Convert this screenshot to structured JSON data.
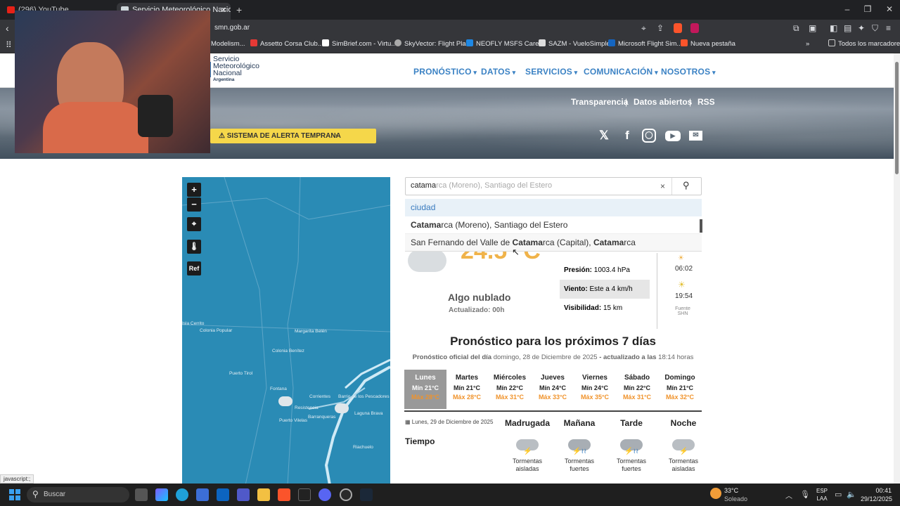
{
  "browser": {
    "tabs": [
      {
        "label": "(296) YouTube"
      },
      {
        "label": "Servicio Meteorológico Naciona"
      }
    ],
    "url": "smn.gob.ar",
    "bookmarks": [
      "Modelism...",
      "Assetto Corsa Club...",
      "SimBrief.com - Virtu...",
      "SkyVector: Flight Pla...",
      "NEOFLY MSFS Care...",
      "SAZM - VueloSimple",
      "Microsoft Flight Sim...",
      "Nueva pestaña"
    ],
    "bookmarks_folder": "Todos los marcadores",
    "status_text": "javascript:;"
  },
  "site": {
    "logo_lines": [
      "Servicio",
      "Meteorológico",
      "Nacional",
      "Argentina"
    ],
    "nav": [
      "PRONÓSTICO",
      "DATOS",
      "SERVICIOS",
      "COMUNICACIÓN",
      "NOSOTROS"
    ],
    "top_links": [
      "Transparencia",
      "Datos abiertos",
      "RSS"
    ],
    "alert_label": "SISTEMA DE ALERTA TEMPRANA"
  },
  "map": {
    "zoom_in": "+",
    "zoom_out": "−",
    "ref_label": "Ref",
    "places": [
      "Colonia Popular",
      "Colonia Benítez",
      "Margarita Belén",
      "Puerto Tirol",
      "Fontana",
      "Resistencia",
      "Corrientes",
      "Barrio de los Pescadores",
      "Laguna Brava",
      "Puerto Vilelas",
      "Barranqueras",
      "Riachuelo",
      "Isla Cerrito"
    ]
  },
  "search": {
    "typed": "catama",
    "suggestion_hint": "rca (Moreno), Santiago del Estero",
    "clear": "×",
    "category": "ciudad",
    "results": [
      {
        "bold": "Catama",
        "rest": "rca (Moreno), Santiago del Estero"
      },
      {
        "pre": "San Fernando del Valle de ",
        "bold": "Catama",
        "mid": "rca (Capital), ",
        "bold2": "Catama",
        "post": "rca"
      }
    ]
  },
  "current": {
    "temperature": "24.5 °C",
    "sky": "Algo nublado",
    "updated": "Actualizado: 00h",
    "pressure_label": "Presión:",
    "pressure": "1003.4 hPa",
    "wind_label": "Viento:",
    "wind": "Este a 4 km/h",
    "visibility_label": "Visibilidad:",
    "visibility": "15 km",
    "sunrise": "06:02",
    "sunset": "19:54",
    "source": "Fuente SHN"
  },
  "forecast": {
    "title": "Pronóstico para los próximos 7 días",
    "subtitle_a": "Pronóstico oficial del día",
    "subtitle_b": "domingo, 28 de Diciembre de 2025",
    "subtitle_c": "- actualizado a las",
    "subtitle_d": "18:14 horas",
    "days": [
      {
        "day": "Lunes",
        "min": "Mín 21°C",
        "max": "Máx 28°C"
      },
      {
        "day": "Martes",
        "min": "Mín 21°C",
        "max": "Máx 28°C"
      },
      {
        "day": "Miércoles",
        "min": "Mín 22°C",
        "max": "Máx 31°C"
      },
      {
        "day": "Jueves",
        "min": "Mín 24°C",
        "max": "Máx 33°C"
      },
      {
        "day": "Viernes",
        "min": "Mín 24°C",
        "max": "Máx 35°C"
      },
      {
        "day": "Sábado",
        "min": "Mín 22°C",
        "max": "Máx 31°C"
      },
      {
        "day": "Domingo",
        "min": "Mín 21°C",
        "max": "Máx 32°C"
      }
    ],
    "detail_date": "Lunes, 29 de Diciembre de 2025",
    "row_label": "Tiempo",
    "periods": [
      {
        "name": "Madrugada",
        "weather": "Tormentas aisladas"
      },
      {
        "name": "Mañana",
        "weather": "Tormentas fuertes"
      },
      {
        "name": "Tarde",
        "weather": "Tormentas fuertes"
      },
      {
        "name": "Noche",
        "weather": "Tormentas aisladas"
      }
    ]
  },
  "taskbar": {
    "search_placeholder": "Buscar",
    "weather_temp": "33°C",
    "weather_desc": "Soleado",
    "lang1": "ESP",
    "lang2": "LAA",
    "time": "00:41",
    "date": "29/12/2025"
  },
  "colors": {
    "accent": "#3b82c4",
    "alert": "#f5d74a",
    "max_temp": "#f0932b",
    "map_water": "#2a8bb5"
  }
}
